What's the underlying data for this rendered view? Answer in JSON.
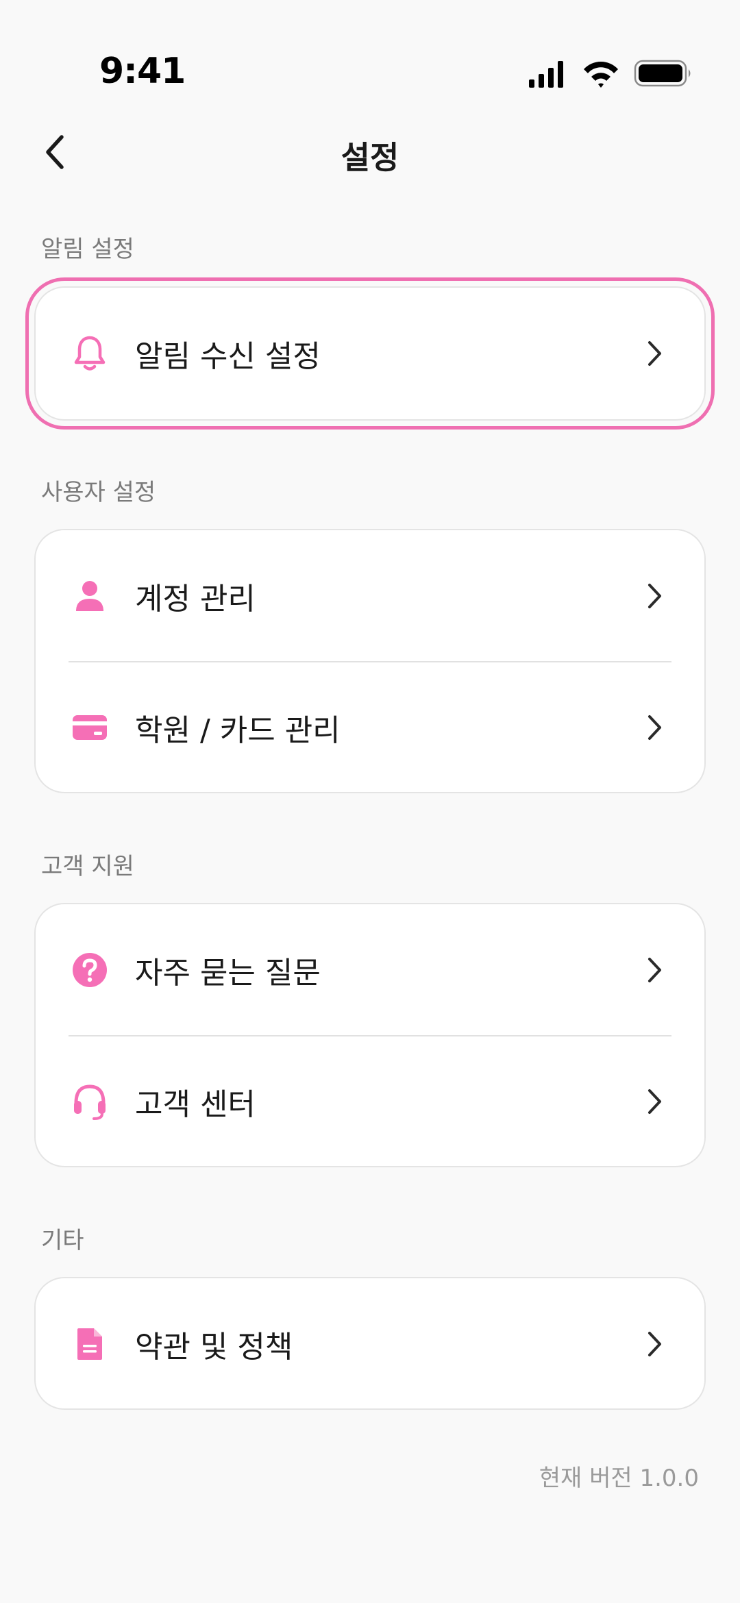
{
  "status_bar": {
    "time": "9:41"
  },
  "header": {
    "title": "설정"
  },
  "sections": [
    {
      "label": "알림 설정",
      "items": [
        {
          "label": "알림 수신 설정",
          "icon": "bell-icon"
        }
      ]
    },
    {
      "label": "사용자 설정",
      "items": [
        {
          "label": "계정 관리",
          "icon": "person-icon"
        },
        {
          "label": "학원 / 카드 관리",
          "icon": "card-icon"
        }
      ]
    },
    {
      "label": "고객 지원",
      "items": [
        {
          "label": "자주 묻는 질문",
          "icon": "question-icon"
        },
        {
          "label": "고객 센터",
          "icon": "headset-icon"
        }
      ]
    },
    {
      "label": "기타",
      "items": [
        {
          "label": "약관 및 정책",
          "icon": "document-icon"
        }
      ]
    }
  ],
  "footer": {
    "version": "현재 버전 1.0.0"
  },
  "colors": {
    "accent": "#F56FB6",
    "highlight_outline": "#EF6FB1",
    "background": "#F9F9F9",
    "card_border": "#E4E4E4",
    "section_label": "#7A7A7A",
    "version_text": "#9A9A9A"
  }
}
